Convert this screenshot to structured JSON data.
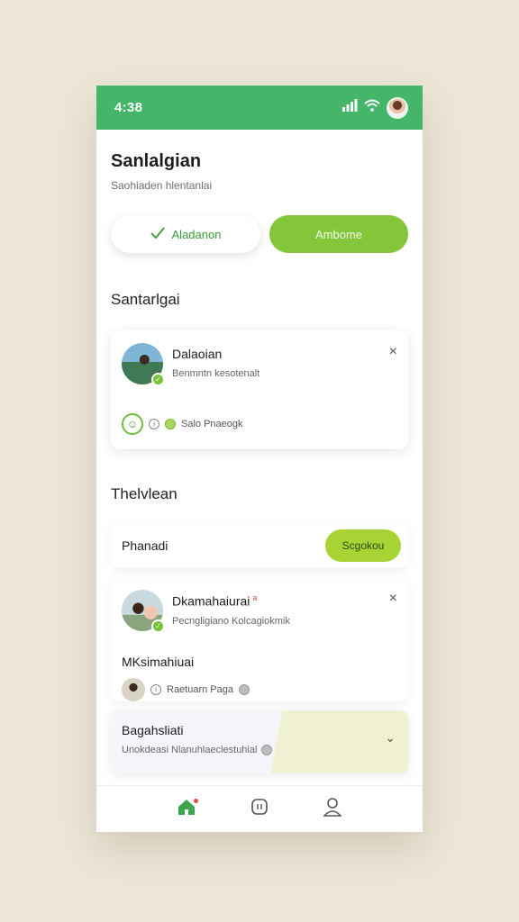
{
  "status_bar": {
    "time": "4:38"
  },
  "header": {
    "title": "Sanlalgian",
    "subtitle": "Saohiaden hlentanlai"
  },
  "actions": {
    "outline_label": "Aladanon",
    "primary_label": "Ambome"
  },
  "section1": {
    "title": "Santarlgai",
    "card": {
      "name": "Dalaoian",
      "description": "Benmntn kesotenalt",
      "meta_text": "Salo Pnaeogk"
    }
  },
  "section2": {
    "title": "Thelvlean",
    "search_label": "Phanadi",
    "search_button": "Scgokou",
    "card": {
      "name": "Dkamahaiurai",
      "badge": "a",
      "description": "Pecngligiano Kolcagiokmik",
      "sub_title": "MKsimahiuai",
      "sub_meta": "Raetuarn Paga"
    }
  },
  "card3": {
    "title": "Bagahsliati",
    "description": "Unokdeasi  Nlanuhlaeclestuhial"
  },
  "colors": {
    "brand_green": "#45b569",
    "accent_lime": "#84c53a"
  },
  "icons": [
    "signal-icon",
    "wifi-icon",
    "check-icon",
    "close-icon",
    "chevron-down-icon",
    "home-icon",
    "square-icon",
    "user-icon"
  ]
}
